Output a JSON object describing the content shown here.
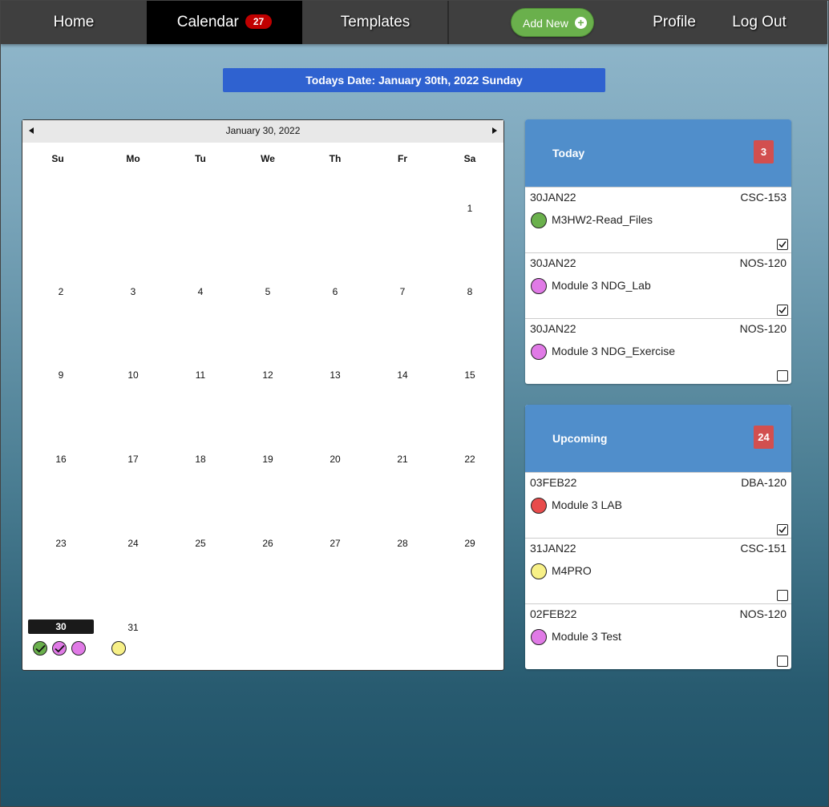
{
  "nav": {
    "home": "Home",
    "calendar": "Calendar",
    "calendar_badge": "27",
    "templates": "Templates",
    "add_new": "Add New",
    "profile": "Profile",
    "logout": "Log Out"
  },
  "banner": "Todays Date: January 30th, 2022 Sunday",
  "calendar": {
    "title": "January 30, 2022",
    "weekdays": [
      "Su",
      "Mo",
      "Tu",
      "We",
      "Th",
      "Fr",
      "Sa"
    ],
    "days": [
      "1",
      "2",
      "3",
      "4",
      "5",
      "6",
      "7",
      "8",
      "9",
      "10",
      "11",
      "12",
      "13",
      "14",
      "15",
      "16",
      "17",
      "18",
      "19",
      "20",
      "21",
      "22",
      "23",
      "24",
      "25",
      "26",
      "27",
      "28",
      "29",
      "30",
      "31"
    ],
    "today": "30",
    "events": {
      "30": [
        {
          "color": "#6ab04c",
          "done": true
        },
        {
          "color": "#e07ae6",
          "done": true
        },
        {
          "color": "#e07ae6",
          "done": false
        }
      ],
      "31": [
        {
          "color": "#f7f087",
          "done": false
        }
      ]
    }
  },
  "today": {
    "title": "Today",
    "count": "3",
    "items": [
      {
        "date": "30JAN22",
        "course": "CSC-153",
        "name": "M3HW2-Read_Files",
        "color": "#6ab04c",
        "checked": true
      },
      {
        "date": "30JAN22",
        "course": "NOS-120",
        "name": "Module 3 NDG_Lab",
        "color": "#e07ae6",
        "checked": true
      },
      {
        "date": "30JAN22",
        "course": "NOS-120",
        "name": "Module 3 NDG_Exercise",
        "color": "#e07ae6",
        "checked": false
      }
    ]
  },
  "upcoming": {
    "title": "Upcoming",
    "count": "24",
    "items": [
      {
        "date": "03FEB22",
        "course": "DBA-120",
        "name": "Module 3 LAB",
        "color": "#e84c4c",
        "checked": true
      },
      {
        "date": "31JAN22",
        "course": "CSC-151",
        "name": "M4PRO",
        "color": "#f7f087",
        "checked": false
      },
      {
        "date": "02FEB22",
        "course": "NOS-120",
        "name": "Module 3 Test",
        "color": "#e07ae6",
        "checked": false
      }
    ]
  }
}
